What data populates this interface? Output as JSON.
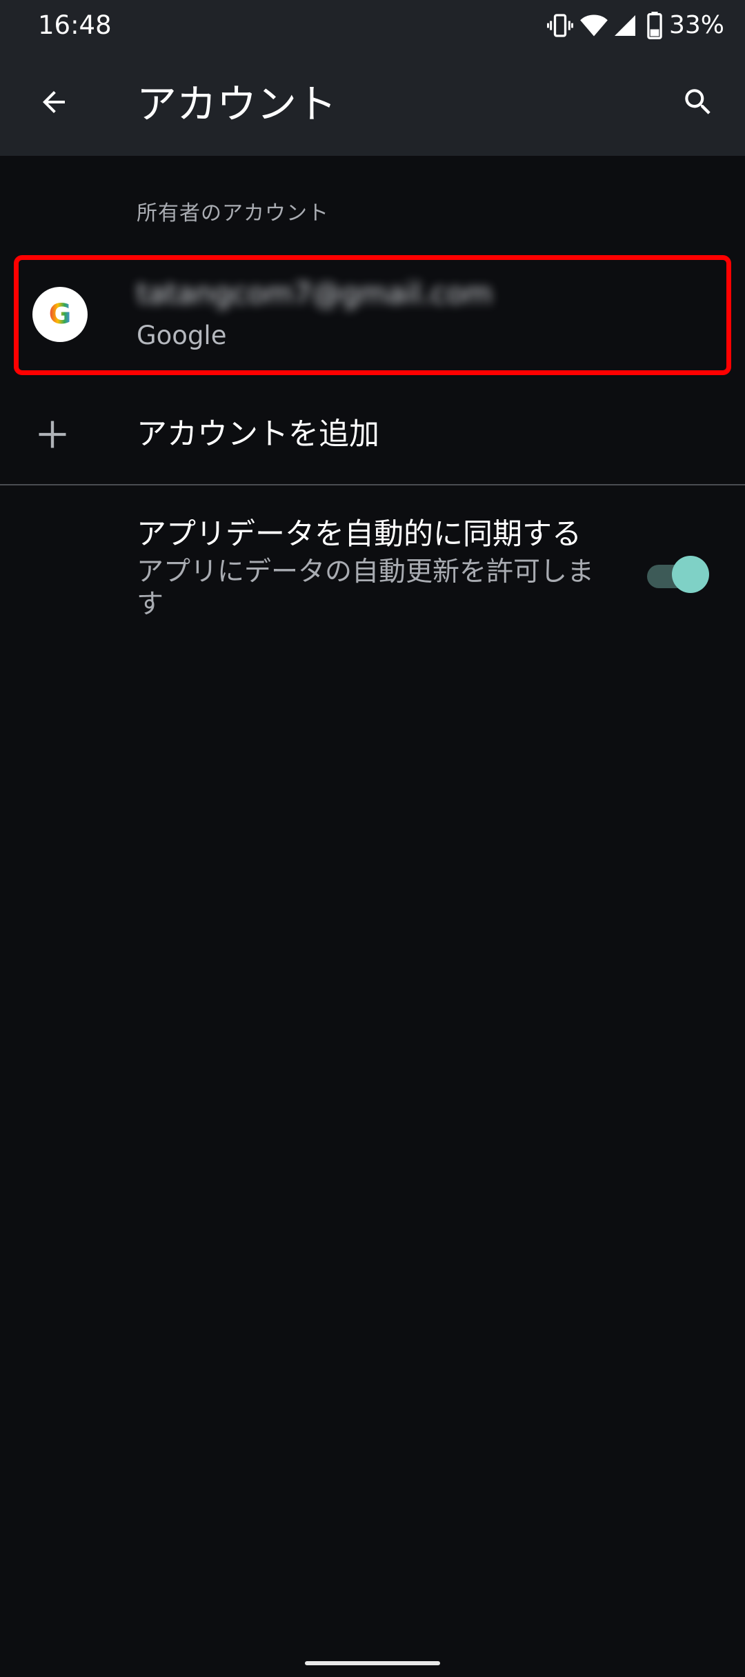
{
  "status_bar": {
    "time": "16:48",
    "battery_percent": "33%",
    "icons": [
      "vibrate-icon",
      "wifi-icon",
      "cell-signal-icon",
      "battery-icon"
    ]
  },
  "app_bar": {
    "title": "アカウント",
    "back_icon": "arrow-left-icon",
    "search_icon": "search-icon"
  },
  "owner_section": {
    "header": "所有者のアカウント",
    "account": {
      "email": "tatangcom7@gmail.com",
      "type": "Google",
      "icon": "google-g-icon",
      "highlighted": true,
      "highlight_color": "#ff0000"
    }
  },
  "add_account": {
    "label": "アカウントを追加",
    "icon": "plus-icon"
  },
  "sync": {
    "title": "アプリデータを自動的に同期する",
    "summary": "アプリにデータの自動更新を許可します",
    "enabled": true,
    "accent_color": "#7fd1c6"
  }
}
